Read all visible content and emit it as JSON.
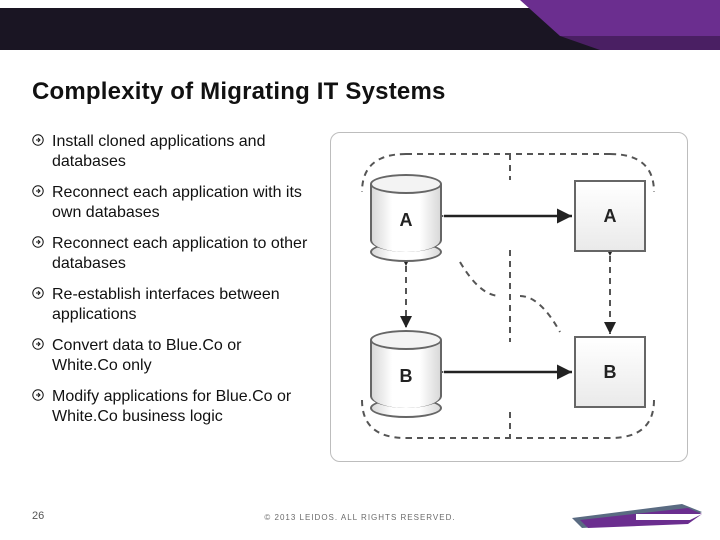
{
  "title": "Complexity of Migrating IT Systems",
  "bullets": [
    "Install cloned applications and databases",
    "Reconnect each application with its own databases",
    "Reconnect each application to other databases",
    "Re-establish interfaces between applications",
    "Convert data to Blue.Co or White.Co only",
    "Modify applications for Blue.Co or White.Co business logic"
  ],
  "diagram": {
    "db_A": "A",
    "app_A": "A",
    "db_B": "B",
    "app_B": "B"
  },
  "footer": {
    "page_number": "26",
    "copyright": "© 2013 LEIDOS. ALL RIGHTS RESERVED."
  },
  "colors": {
    "brand_purple": "#6b2e8f",
    "brand_dark": "#1a1523",
    "brand_slate": "#5a6b82"
  }
}
